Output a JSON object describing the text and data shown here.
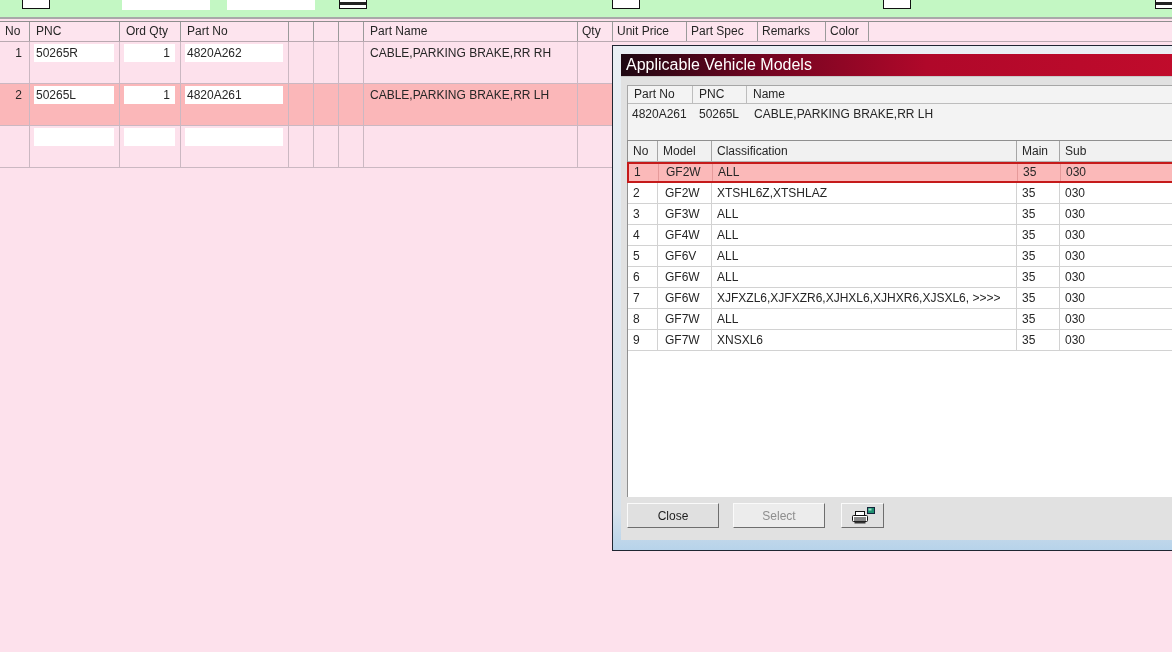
{
  "parts_table": {
    "columns": [
      {
        "kind": "heading",
        "label": "No"
      },
      {
        "kind": "heading",
        "label": "PNC"
      },
      {
        "kind": "heading",
        "label": "Ord Qty"
      },
      {
        "kind": "heading",
        "label": "Part No"
      },
      {
        "kind": "blank"
      },
      {
        "kind": "blank"
      },
      {
        "kind": "blank"
      },
      {
        "kind": "heading",
        "label": "Part Name"
      },
      {
        "kind": "heading",
        "label": "Qty"
      },
      {
        "kind": "heading",
        "label": "Unit Price"
      },
      {
        "kind": "heading",
        "label": "Part Spec"
      },
      {
        "kind": "heading",
        "label": "Remarks"
      },
      {
        "kind": "heading",
        "label": "Color"
      }
    ],
    "rows": [
      {
        "no": "1",
        "pnc": "50265R",
        "ord_qty": "1",
        "part_no": "4820A262",
        "part_name": "CABLE,PARKING BRAKE,RR RH",
        "selected": false
      },
      {
        "no": "2",
        "pnc": "50265L",
        "ord_qty": "1",
        "part_no": "4820A261",
        "part_name": "CABLE,PARKING BRAKE,RR LH",
        "selected": true
      },
      {
        "selected": false
      }
    ]
  },
  "dialog": {
    "title": "Applicable Vehicle Models",
    "part_info": {
      "columns": [
        "Part No",
        "PNC",
        "Name"
      ],
      "values": [
        "4820A261",
        "50265L",
        "CABLE,PARKING BRAKE,RR LH"
      ]
    },
    "models_table": {
      "columns": [
        "No",
        "Model",
        "Classification",
        "Main",
        "Sub"
      ],
      "rows": [
        {
          "no": "1",
          "model": "GF2W",
          "classification": "ALL",
          "main": "35",
          "sub": "030",
          "selected": true
        },
        {
          "no": "2",
          "model": "GF2W",
          "classification": "XTSHL6Z,XTSHLAZ",
          "main": "35",
          "sub": "030",
          "selected": false
        },
        {
          "no": "3",
          "model": "GF3W",
          "classification": "ALL",
          "main": "35",
          "sub": "030",
          "selected": false
        },
        {
          "no": "4",
          "model": "GF4W",
          "classification": "ALL",
          "main": "35",
          "sub": "030",
          "selected": false
        },
        {
          "no": "5",
          "model": "GF6V",
          "classification": "ALL",
          "main": "35",
          "sub": "030",
          "selected": false
        },
        {
          "no": "6",
          "model": "GF6W",
          "classification": "ALL",
          "main": "35",
          "sub": "030",
          "selected": false
        },
        {
          "no": "7",
          "model": "GF6W",
          "classification": "XJFXZL6,XJFXZR6,XJHXL6,XJHXR6,XJSXL6,  >>>>",
          "main": "35",
          "sub": "030",
          "selected": false
        },
        {
          "no": "8",
          "model": "GF7W",
          "classification": "ALL",
          "main": "35",
          "sub": "030",
          "selected": false
        },
        {
          "no": "9",
          "model": "GF7W",
          "classification": "XNSXL6",
          "main": "35",
          "sub": "030",
          "selected": false
        }
      ]
    },
    "buttons": [
      {
        "kind": "text",
        "label": "Close",
        "disabled": false
      },
      {
        "kind": "text",
        "label": "Select",
        "disabled": true
      },
      {
        "kind": "print",
        "disabled": false
      }
    ]
  }
}
